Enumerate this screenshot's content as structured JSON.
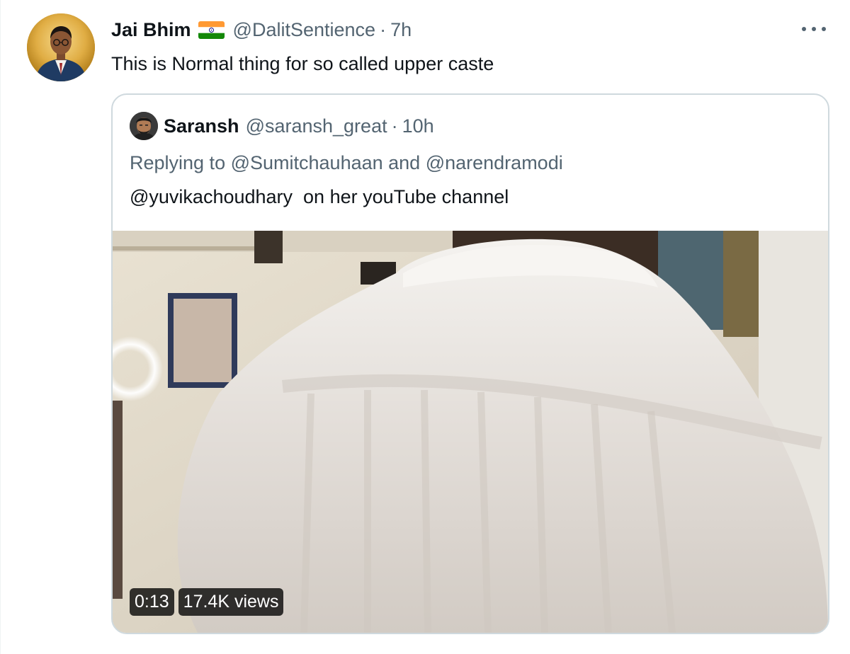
{
  "tweet": {
    "display_name": "Jai Bhim",
    "flag_icon": "india-flag-icon",
    "handle": "@DalitSentience",
    "separator": "·",
    "time": "7h",
    "text": "This is Normal thing for so called upper caste",
    "more_icon": "more-horizontal-icon"
  },
  "quoted": {
    "display_name": "Saransh",
    "handle": "@saransh_great",
    "separator": "·",
    "time": "10h",
    "replying_prefix": "Replying to ",
    "replying_to": [
      "@Sumitchauhaan",
      "@narendramodi"
    ],
    "replying_joiner": " and ",
    "text": "@yuvikachoudhary  on her youTube channel",
    "video": {
      "duration": "0:13",
      "views": "17.4K views"
    }
  },
  "colors": {
    "text_primary": "#0f1419",
    "text_secondary": "#536471",
    "border": "#cfd9de",
    "background": "#ffffff"
  }
}
